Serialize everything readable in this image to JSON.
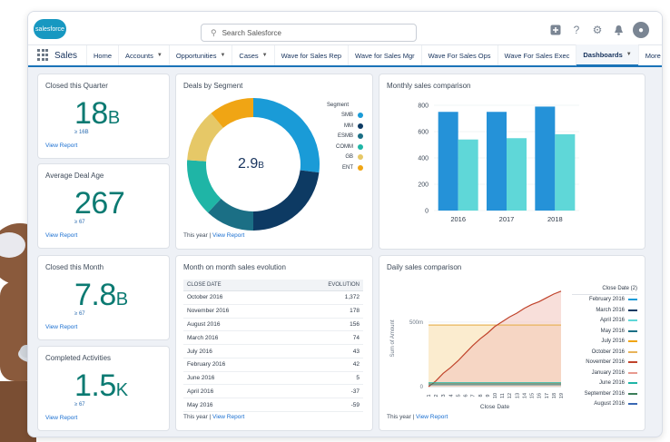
{
  "topbar": {
    "logo_text": "salesforce",
    "search_placeholder": "Search Salesforce",
    "icons": [
      "add-icon",
      "help-icon",
      "gear-icon",
      "bell-icon",
      "avatar"
    ]
  },
  "nav": {
    "app_name": "Sales",
    "items": [
      {
        "label": "Home",
        "dropdown": false
      },
      {
        "label": "Accounts",
        "dropdown": true
      },
      {
        "label": "Opportunities",
        "dropdown": true
      },
      {
        "label": "Cases",
        "dropdown": true
      },
      {
        "label": "Wave for Sales Rep",
        "dropdown": false
      },
      {
        "label": "Wave for Sales Mgr",
        "dropdown": false
      },
      {
        "label": "Wave For Sales Ops",
        "dropdown": false
      },
      {
        "label": "Wave For Sales Exec",
        "dropdown": false
      },
      {
        "label": "Dashboards",
        "dropdown": true,
        "active": true
      },
      {
        "label": "More",
        "dropdown": true
      }
    ]
  },
  "kpis": [
    {
      "title": "Closed this Quarter",
      "value": "18",
      "unit": "B",
      "sub": "≥ 16B",
      "link": "View Report"
    },
    {
      "title": "Average Deal Age",
      "value": "267",
      "unit": "",
      "sub": "≥ 67",
      "link": "View Report"
    },
    {
      "title": "Closed this Month",
      "value": "7.8",
      "unit": "B",
      "sub": "≥ 67",
      "link": "View Report"
    },
    {
      "title": "Completed Activities",
      "value": "1.5",
      "unit": "K",
      "sub": "≥ 67",
      "link": "View Report"
    }
  ],
  "segment": {
    "title": "Deals by Segment",
    "center_value": "2.9",
    "center_unit": "B",
    "legend_title": "Segment",
    "footer_static": "This year | ",
    "footer_link": "View Report"
  },
  "monthly": {
    "title": "Monthly sales comparison"
  },
  "evolution": {
    "title": "Month on month sales evolution",
    "col_close": "CLOSE DATE",
    "col_evo": "EVOLUTION",
    "rows": [
      {
        "date": "October 2016",
        "evo": "1,372"
      },
      {
        "date": "November 2016",
        "evo": "178"
      },
      {
        "date": "August 2016",
        "evo": "156"
      },
      {
        "date": "March 2016",
        "evo": "74"
      },
      {
        "date": "July 2016",
        "evo": "43"
      },
      {
        "date": "February 2016",
        "evo": "42"
      },
      {
        "date": "June 2016",
        "evo": "5"
      },
      {
        "date": "April 2016",
        "evo": "-37"
      },
      {
        "date": "May 2016",
        "evo": "-59"
      }
    ],
    "footer_static": "This year | ",
    "footer_link": "View Report"
  },
  "daily": {
    "title": "Daily sales comparison",
    "legend_title": "Close Date (2)",
    "ylabel": "Sum of Amount",
    "xlabel": "Close Date",
    "y_tick_500": "500m",
    "y_tick_0": "0",
    "footer_static": "This year | ",
    "footer_link": "View Report"
  },
  "chart_data": [
    {
      "type": "pie",
      "title": "Deals by Segment",
      "donut": true,
      "center_label": "2.9B",
      "legend_title": "Segment",
      "categories": [
        "SMB",
        "MM",
        "ESMB",
        "COMM",
        "GB",
        "ENT"
      ],
      "values": [
        27,
        23,
        12,
        14,
        13,
        11
      ],
      "colors": [
        "#1a9bd7",
        "#0d3a63",
        "#1b6f85",
        "#1fb5a6",
        "#e6c867",
        "#f0a514"
      ]
    },
    {
      "type": "bar",
      "title": "Monthly sales comparison",
      "categories": [
        "2016",
        "2017",
        "2018"
      ],
      "ylim": [
        0,
        800
      ],
      "yticks": [
        0,
        200,
        400,
        600,
        800
      ],
      "series": [
        {
          "name": "",
          "values": [
            750,
            750,
            790
          ],
          "color": "#2592d8"
        },
        {
          "name": "",
          "values": [
            540,
            550,
            580
          ],
          "color": "#5fd7d8"
        }
      ]
    },
    {
      "type": "line",
      "title": "Daily sales comparison",
      "xlabel": "Close Date",
      "ylabel": "Sum of Amount",
      "x": [
        1,
        2,
        3,
        4,
        5,
        6,
        7,
        8,
        9,
        10,
        11,
        12,
        13,
        14,
        15,
        16,
        17,
        18,
        19
      ],
      "y_ticks": [
        "0",
        "500m"
      ],
      "legend_title": "Close Date (2)",
      "series": [
        {
          "name": "February 2016",
          "color": "#1a9bd7"
        },
        {
          "name": "March 2016",
          "color": "#0d3a63"
        },
        {
          "name": "April 2016",
          "color": "#5fd7d8"
        },
        {
          "name": "May 2016",
          "color": "#1b6f85"
        },
        {
          "name": "July 2016",
          "color": "#f0a514"
        },
        {
          "name": "October 2016",
          "color": "#e8b45a",
          "values": [
            100,
            100,
            100,
            100,
            100,
            100,
            100,
            100,
            100,
            100,
            100,
            100,
            100,
            100,
            100,
            100,
            100,
            100,
            100
          ]
        },
        {
          "name": "November 2016",
          "color": "#c0432b",
          "values": [
            0,
            6,
            14,
            20,
            27,
            35,
            43,
            50,
            56,
            63,
            68,
            73,
            77,
            82,
            86,
            89,
            93,
            97,
            100
          ]
        },
        {
          "name": "January 2016",
          "color": "#e89a8f"
        },
        {
          "name": "June 2016",
          "color": "#1fb5a6"
        },
        {
          "name": "September 2016",
          "color": "#3c7e59"
        },
        {
          "name": "August 2016",
          "color": "#3a68b3"
        }
      ]
    }
  ]
}
